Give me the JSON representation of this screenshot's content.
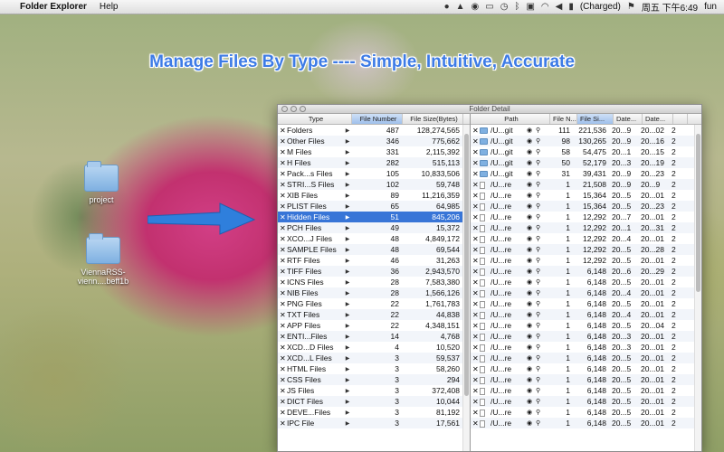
{
  "menubar": {
    "app_name": "Folder Explorer",
    "menus": [
      "Help"
    ],
    "battery": "(Charged)",
    "clock": "周五 下午6:49",
    "user": "fun"
  },
  "banner": "Manage Files By Type ---- Simple, Intuitive, Accurate",
  "desktop": {
    "icons": [
      {
        "label": "project"
      },
      {
        "label": "ViennaRSS-vienn....beff1b"
      }
    ]
  },
  "window": {
    "title": "Folder Detail",
    "left_headers": [
      "Type",
      "File Number",
      "File Size(Bytes)"
    ],
    "left_rows": [
      {
        "type": "Folders",
        "num": "487",
        "size": "128,274,565"
      },
      {
        "type": "Other Files",
        "num": "346",
        "size": "775,662"
      },
      {
        "type": "M Files",
        "num": "331",
        "size": "2,115,392"
      },
      {
        "type": "H Files",
        "num": "282",
        "size": "515,113"
      },
      {
        "type": "Pack...s Files",
        "num": "105",
        "size": "10,833,506"
      },
      {
        "type": "STRI...S Files",
        "num": "102",
        "size": "59,748"
      },
      {
        "type": "XIB Files",
        "num": "89",
        "size": "11,216,359"
      },
      {
        "type": "PLIST Files",
        "num": "65",
        "size": "64,985"
      },
      {
        "type": "Hidden Files",
        "num": "51",
        "size": "845,206"
      },
      {
        "type": "PCH Files",
        "num": "49",
        "size": "15,372"
      },
      {
        "type": "XCO...J Files",
        "num": "48",
        "size": "4,849,172"
      },
      {
        "type": "SAMPLE Files",
        "num": "48",
        "size": "69,544"
      },
      {
        "type": "RTF Files",
        "num": "46",
        "size": "31,263"
      },
      {
        "type": "TIFF Files",
        "num": "36",
        "size": "2,943,570"
      },
      {
        "type": "ICNS Files",
        "num": "28",
        "size": "7,583,380"
      },
      {
        "type": "NIB Files",
        "num": "28",
        "size": "1,566,126"
      },
      {
        "type": "PNG Files",
        "num": "22",
        "size": "1,761,783"
      },
      {
        "type": "TXT Files",
        "num": "22",
        "size": "44,838"
      },
      {
        "type": "APP Files",
        "num": "22",
        "size": "4,348,151"
      },
      {
        "type": "ENTI...Files",
        "num": "14",
        "size": "4,768"
      },
      {
        "type": "XCD...D Files",
        "num": "4",
        "size": "10,520"
      },
      {
        "type": "XCD...L Files",
        "num": "3",
        "size": "59,537"
      },
      {
        "type": "HTML Files",
        "num": "3",
        "size": "58,260"
      },
      {
        "type": "CSS Files",
        "num": "3",
        "size": "294"
      },
      {
        "type": "JS Files",
        "num": "3",
        "size": "372,408"
      },
      {
        "type": "DICT Files",
        "num": "3",
        "size": "10,044"
      },
      {
        "type": "DEVE...Files",
        "num": "3",
        "size": "81,192"
      },
      {
        "type": "IPC File",
        "num": "3",
        "size": "17,561"
      }
    ],
    "right_headers": [
      "Path",
      "File N...",
      "File Si...",
      "Date...",
      "Date...",
      ""
    ],
    "right_rows": [
      {
        "icon": "folder",
        "path": "/U...git",
        "n": "111",
        "size": "221,536",
        "d1": "20...9",
        "d2": "20...02",
        "d3": "2"
      },
      {
        "icon": "folder",
        "path": "/U...git",
        "n": "98",
        "size": "130,265",
        "d1": "20...9",
        "d2": "20...16",
        "d3": "2"
      },
      {
        "icon": "folder",
        "path": "/U...git",
        "n": "58",
        "size": "54,475",
        "d1": "20...1",
        "d2": "20...15",
        "d3": "2"
      },
      {
        "icon": "folder",
        "path": "/U...git",
        "n": "50",
        "size": "52,179",
        "d1": "20...3",
        "d2": "20...19",
        "d3": "2"
      },
      {
        "icon": "folder",
        "path": "/U...git",
        "n": "31",
        "size": "39,431",
        "d1": "20...9",
        "d2": "20...23",
        "d3": "2"
      },
      {
        "icon": "file",
        "path": "/U...re",
        "n": "1",
        "size": "21,508",
        "d1": "20...9",
        "d2": "20...9",
        "d3": "2"
      },
      {
        "icon": "file",
        "path": "/U...re",
        "n": "1",
        "size": "15,364",
        "d1": "20...5",
        "d2": "20...01",
        "d3": "2"
      },
      {
        "icon": "file",
        "path": "/U...re",
        "n": "1",
        "size": "15,364",
        "d1": "20...5",
        "d2": "20...23",
        "d3": "2"
      },
      {
        "icon": "file",
        "path": "/U...re",
        "n": "1",
        "size": "12,292",
        "d1": "20...7",
        "d2": "20...01",
        "d3": "2"
      },
      {
        "icon": "file",
        "path": "/U...re",
        "n": "1",
        "size": "12,292",
        "d1": "20...1",
        "d2": "20...31",
        "d3": "2"
      },
      {
        "icon": "file",
        "path": "/U...re",
        "n": "1",
        "size": "12,292",
        "d1": "20...4",
        "d2": "20...01",
        "d3": "2"
      },
      {
        "icon": "file",
        "path": "/U...re",
        "n": "1",
        "size": "12,292",
        "d1": "20...5",
        "d2": "20...28",
        "d3": "2"
      },
      {
        "icon": "file",
        "path": "/U...re",
        "n": "1",
        "size": "12,292",
        "d1": "20...5",
        "d2": "20...01",
        "d3": "2"
      },
      {
        "icon": "file",
        "path": "/U...re",
        "n": "1",
        "size": "6,148",
        "d1": "20...6",
        "d2": "20...29",
        "d3": "2"
      },
      {
        "icon": "file",
        "path": "/U...re",
        "n": "1",
        "size": "6,148",
        "d1": "20...5",
        "d2": "20...01",
        "d3": "2"
      },
      {
        "icon": "file",
        "path": "/U...re",
        "n": "1",
        "size": "6,148",
        "d1": "20...4",
        "d2": "20...01",
        "d3": "2"
      },
      {
        "icon": "file",
        "path": "/U...re",
        "n": "1",
        "size": "6,148",
        "d1": "20...5",
        "d2": "20...01",
        "d3": "2"
      },
      {
        "icon": "file",
        "path": "/U...re",
        "n": "1",
        "size": "6,148",
        "d1": "20...4",
        "d2": "20...01",
        "d3": "2"
      },
      {
        "icon": "file",
        "path": "/U...re",
        "n": "1",
        "size": "6,148",
        "d1": "20...5",
        "d2": "20...04",
        "d3": "2"
      },
      {
        "icon": "file",
        "path": "/U...re",
        "n": "1",
        "size": "6,148",
        "d1": "20...3",
        "d2": "20...01",
        "d3": "2"
      },
      {
        "icon": "file",
        "path": "/U...re",
        "n": "1",
        "size": "6,148",
        "d1": "20...3",
        "d2": "20...01",
        "d3": "2"
      },
      {
        "icon": "file",
        "path": "/U...re",
        "n": "1",
        "size": "6,148",
        "d1": "20...5",
        "d2": "20...01",
        "d3": "2"
      },
      {
        "icon": "file",
        "path": "/U...re",
        "n": "1",
        "size": "6,148",
        "d1": "20...5",
        "d2": "20...01",
        "d3": "2"
      },
      {
        "icon": "file",
        "path": "/U...re",
        "n": "1",
        "size": "6,148",
        "d1": "20...5",
        "d2": "20...01",
        "d3": "2"
      },
      {
        "icon": "file",
        "path": "/U...re",
        "n": "1",
        "size": "6,148",
        "d1": "20...5",
        "d2": "20...01",
        "d3": "2"
      },
      {
        "icon": "file",
        "path": "/U...re",
        "n": "1",
        "size": "6,148",
        "d1": "20...5",
        "d2": "20...01",
        "d3": "2"
      },
      {
        "icon": "file",
        "path": "/U...re",
        "n": "1",
        "size": "6,148",
        "d1": "20...5",
        "d2": "20...01",
        "d3": "2"
      },
      {
        "icon": "file",
        "path": "/U...re",
        "n": "1",
        "size": "6,148",
        "d1": "20...5",
        "d2": "20...01",
        "d3": "2"
      }
    ],
    "selected_left_index": 8
  }
}
